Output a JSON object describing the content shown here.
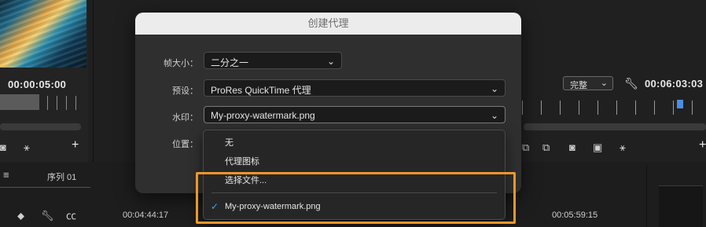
{
  "dialog": {
    "title": "创建代理",
    "frame_size": {
      "label": "帧大小：",
      "value": "二分之一"
    },
    "preset": {
      "label": "预设：",
      "value": "ProRes QuickTime 代理"
    },
    "watermark": {
      "label": "水印：",
      "value": "My-proxy-watermark.png"
    },
    "position": {
      "label": "位置："
    }
  },
  "watermark_menu": {
    "items": [
      "无",
      "代理图标",
      "选择文件...",
      "My-proxy-watermark.png"
    ],
    "checked_index": 3
  },
  "source_monitor": {
    "timecode": "00:00:05:00"
  },
  "program_monitor": {
    "quality": "完整",
    "timecode": "00:06:03:03"
  },
  "timeline": {
    "sequence_tab": "序列 01",
    "time_left": "00:04:44:17",
    "time_right": "00:05:59:15"
  },
  "colors": {
    "highlight": "#f0962a",
    "accent": "#4a9cf0",
    "header_bg": "#ececec"
  }
}
